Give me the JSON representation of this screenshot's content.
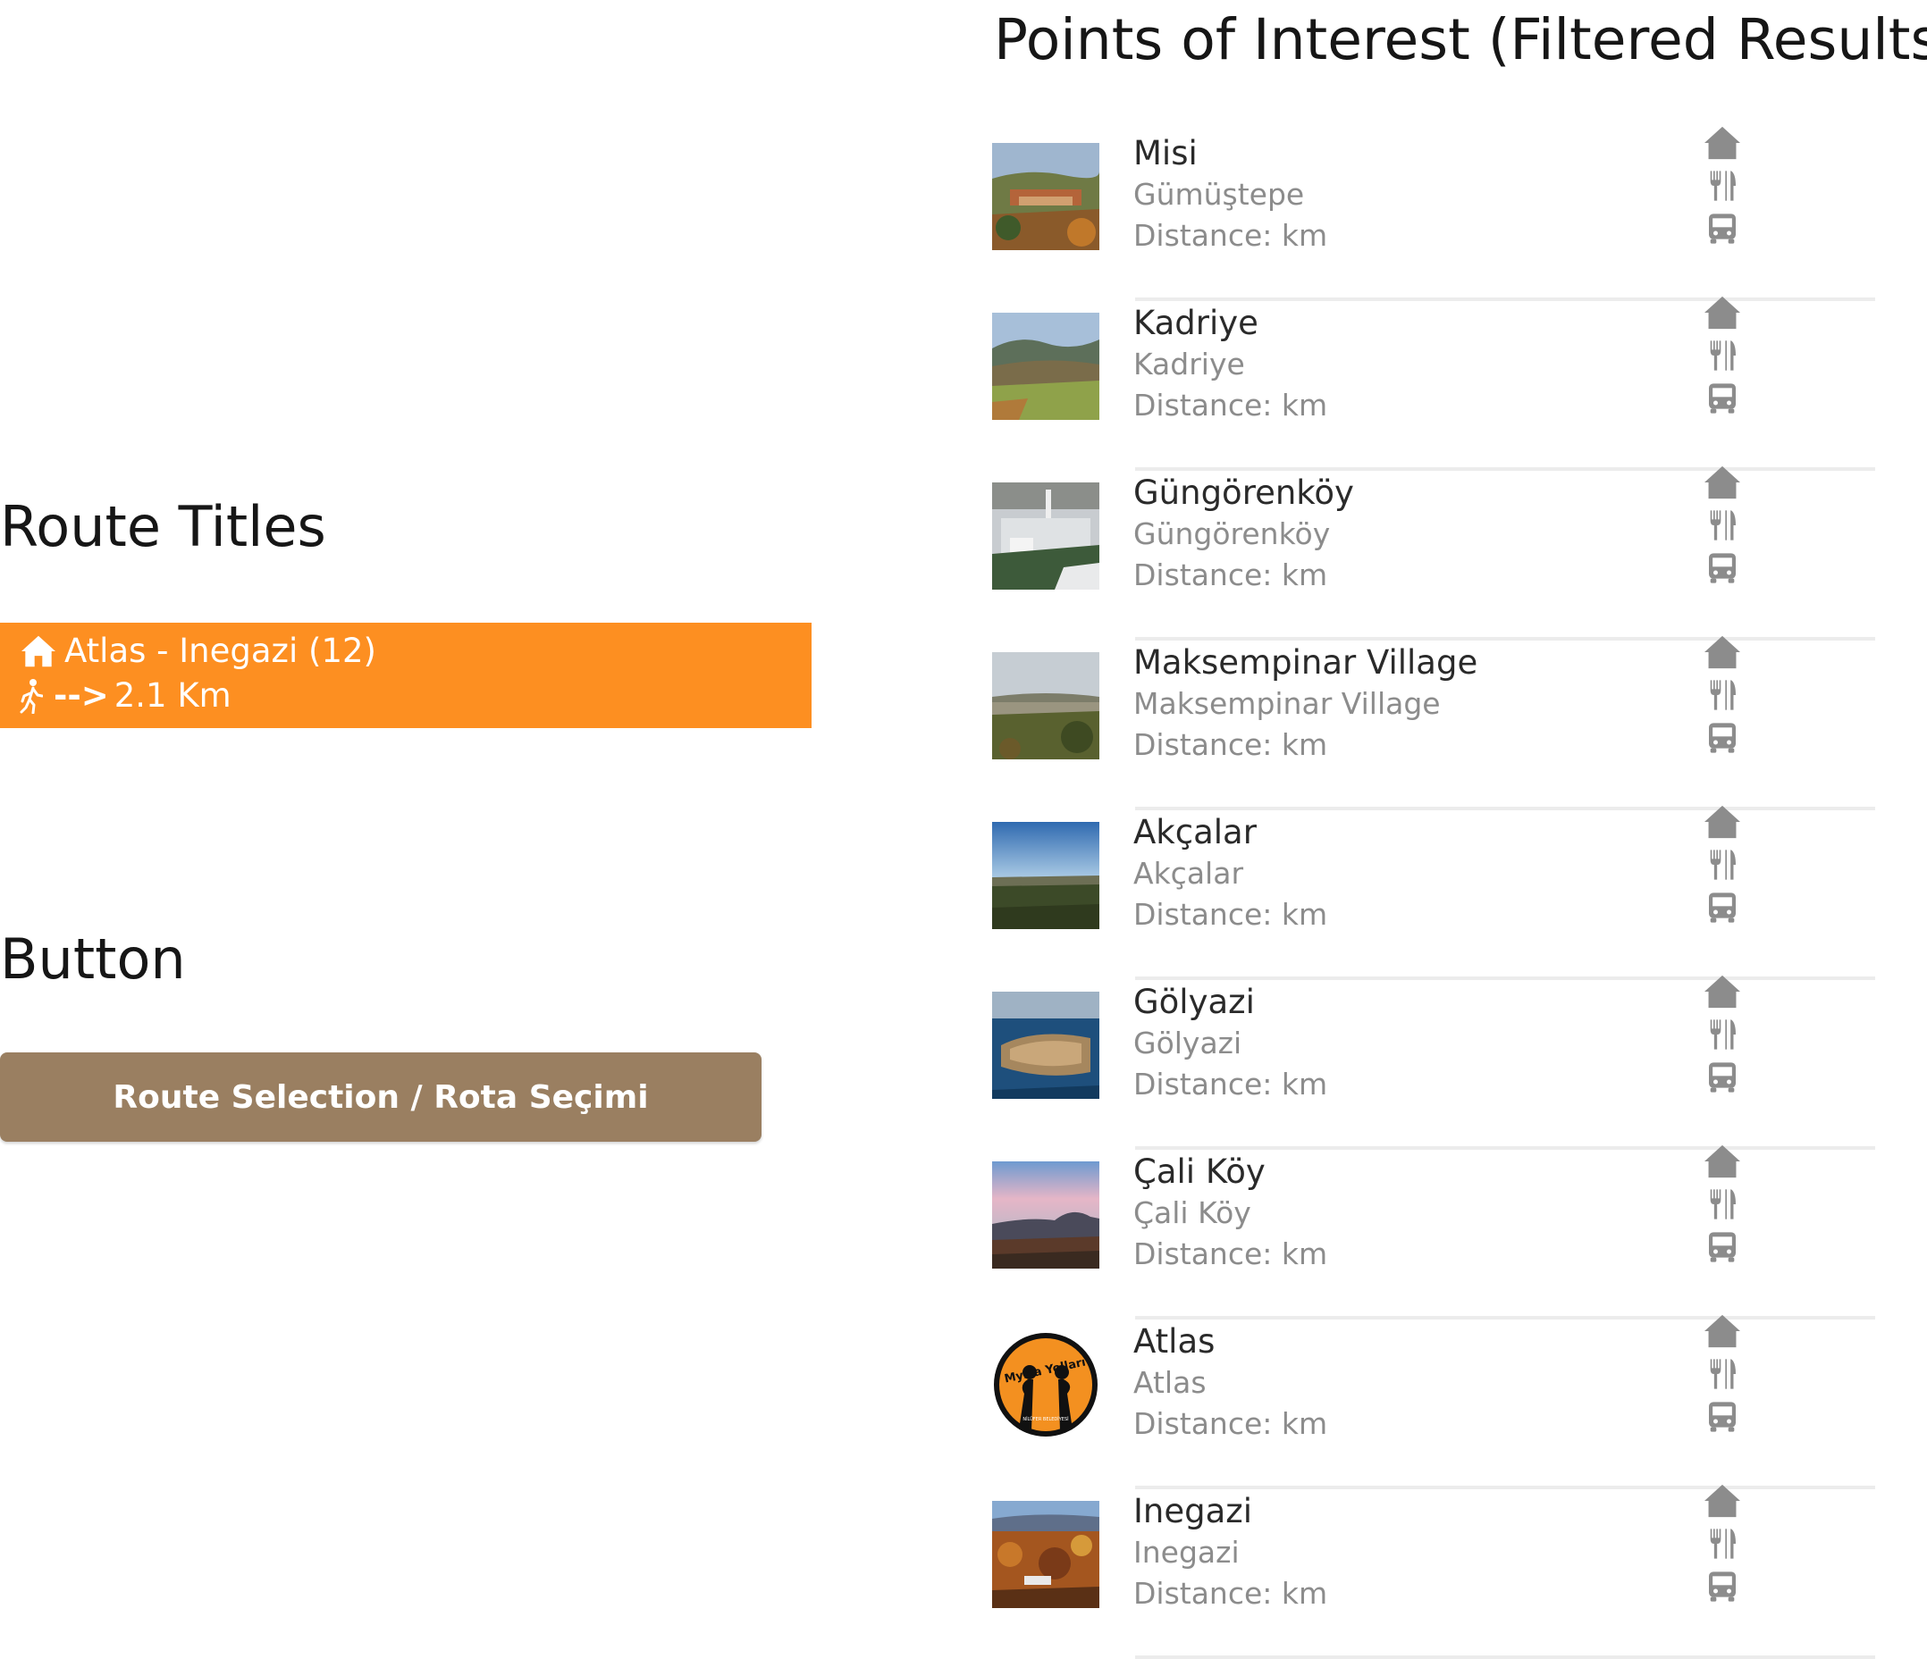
{
  "headings": {
    "route_titles": "Route Titles",
    "button": "Button",
    "poi": "Points of Interest (Filtered Results)"
  },
  "route": {
    "title": "Atlas - Inegazi (12)",
    "arrow": "-->",
    "distance": "2.1 Km",
    "home_icon": "home-icon",
    "walk_icon": "walking-person-icon",
    "background": "#fd8f21"
  },
  "button": {
    "label": "Route Selection / Rota Seçimi",
    "background": "#9a7f61"
  },
  "poi_list": [
    {
      "name": "Misi",
      "subtitle": "Gümüştepe",
      "distance": "Distance: km"
    },
    {
      "name": "Kadriye",
      "subtitle": "Kadriye",
      "distance": "Distance: km"
    },
    {
      "name": "Güngörenköy",
      "subtitle": "Güngörenköy",
      "distance": "Distance: km"
    },
    {
      "name": "Maksempinar Village",
      "subtitle": "Maksempinar Village",
      "distance": "Distance: km"
    },
    {
      "name": "Akçalar",
      "subtitle": "Akçalar",
      "distance": "Distance: km"
    },
    {
      "name": "Gölyazi",
      "subtitle": "Gölyazi",
      "distance": "Distance: km"
    },
    {
      "name": "Çali Köy",
      "subtitle": "Çali Köy",
      "distance": "Distance: km"
    },
    {
      "name": "Atlas",
      "subtitle": "Atlas",
      "distance": "Distance: km",
      "logo_text": "Mysia Yolları",
      "logo_arc_text": "Mysia'dan Apollonia ad Rhyndacum'a",
      "logo_footer": "NİLÜFER BELEDİYESİ"
    },
    {
      "name": "Inegazi",
      "subtitle": "Inegazi",
      "distance": "Distance: km"
    }
  ],
  "poi_icons": [
    "home-icon",
    "utensils-icon",
    "bus-icon"
  ],
  "colors": {
    "icon_gray": "#8c8c8c",
    "divider": "#ececec"
  }
}
